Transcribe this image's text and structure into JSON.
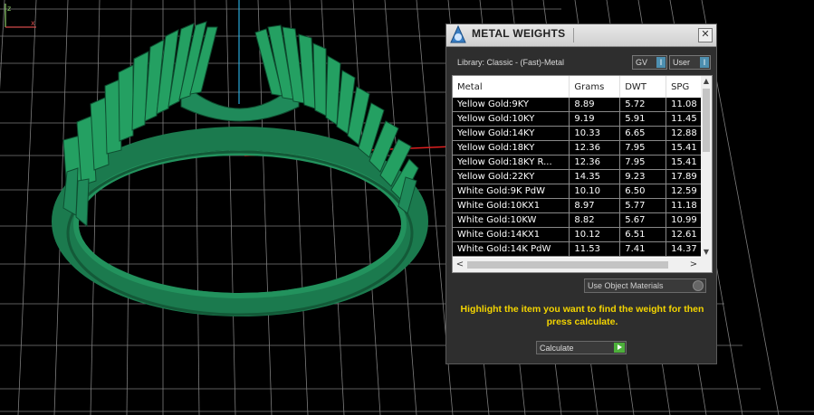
{
  "dialog": {
    "title": "METAL WEIGHTS",
    "close_glyph": "✕",
    "library": "Library: Classic - (Fast)-Metal",
    "toggles": {
      "gv_label": "GV",
      "user_label": "User",
      "indicator": "I"
    },
    "table": {
      "columns": [
        "Metal",
        "Grams",
        "DWT",
        "SPG"
      ],
      "rows": [
        [
          "Yellow Gold:9KY",
          "8.89",
          "5.72",
          "11.08"
        ],
        [
          "Yellow Gold:10KY",
          "9.19",
          "5.91",
          "11.45"
        ],
        [
          "Yellow Gold:14KY",
          "10.33",
          "6.65",
          "12.88"
        ],
        [
          "Yellow Gold:18KY",
          "12.36",
          "7.95",
          "15.41"
        ],
        [
          "Yellow Gold:18KY R...",
          "12.36",
          "7.95",
          "15.41"
        ],
        [
          "Yellow Gold:22KY",
          "14.35",
          "9.23",
          "17.89"
        ],
        [
          "White Gold:9K PdW",
          "10.10",
          "6.50",
          "12.59"
        ],
        [
          "White Gold:10KX1",
          "8.97",
          "5.77",
          "11.18"
        ],
        [
          "White Gold:10KW",
          "8.82",
          "5.67",
          "10.99"
        ],
        [
          "White Gold:14KX1",
          "10.12",
          "6.51",
          "12.61"
        ],
        [
          "White Gold:14K PdW",
          "11.53",
          "7.41",
          "14.37"
        ]
      ]
    },
    "use_object_materials": "Use Object Materials",
    "instructions": "Highlight the item you want to find the weight for then press calculate.",
    "calculate_label": "Calculate",
    "colors": {
      "instruction_text": "#f4d500",
      "ring_green": "#1f8a5a",
      "go_green": "#4caf3a"
    },
    "icons": [
      "app-logo-icon",
      "close-icon",
      "scroll-up-icon",
      "scroll-down-icon",
      "scroll-left-icon",
      "scroll-right-icon",
      "play-icon",
      "axis-icon"
    ]
  }
}
